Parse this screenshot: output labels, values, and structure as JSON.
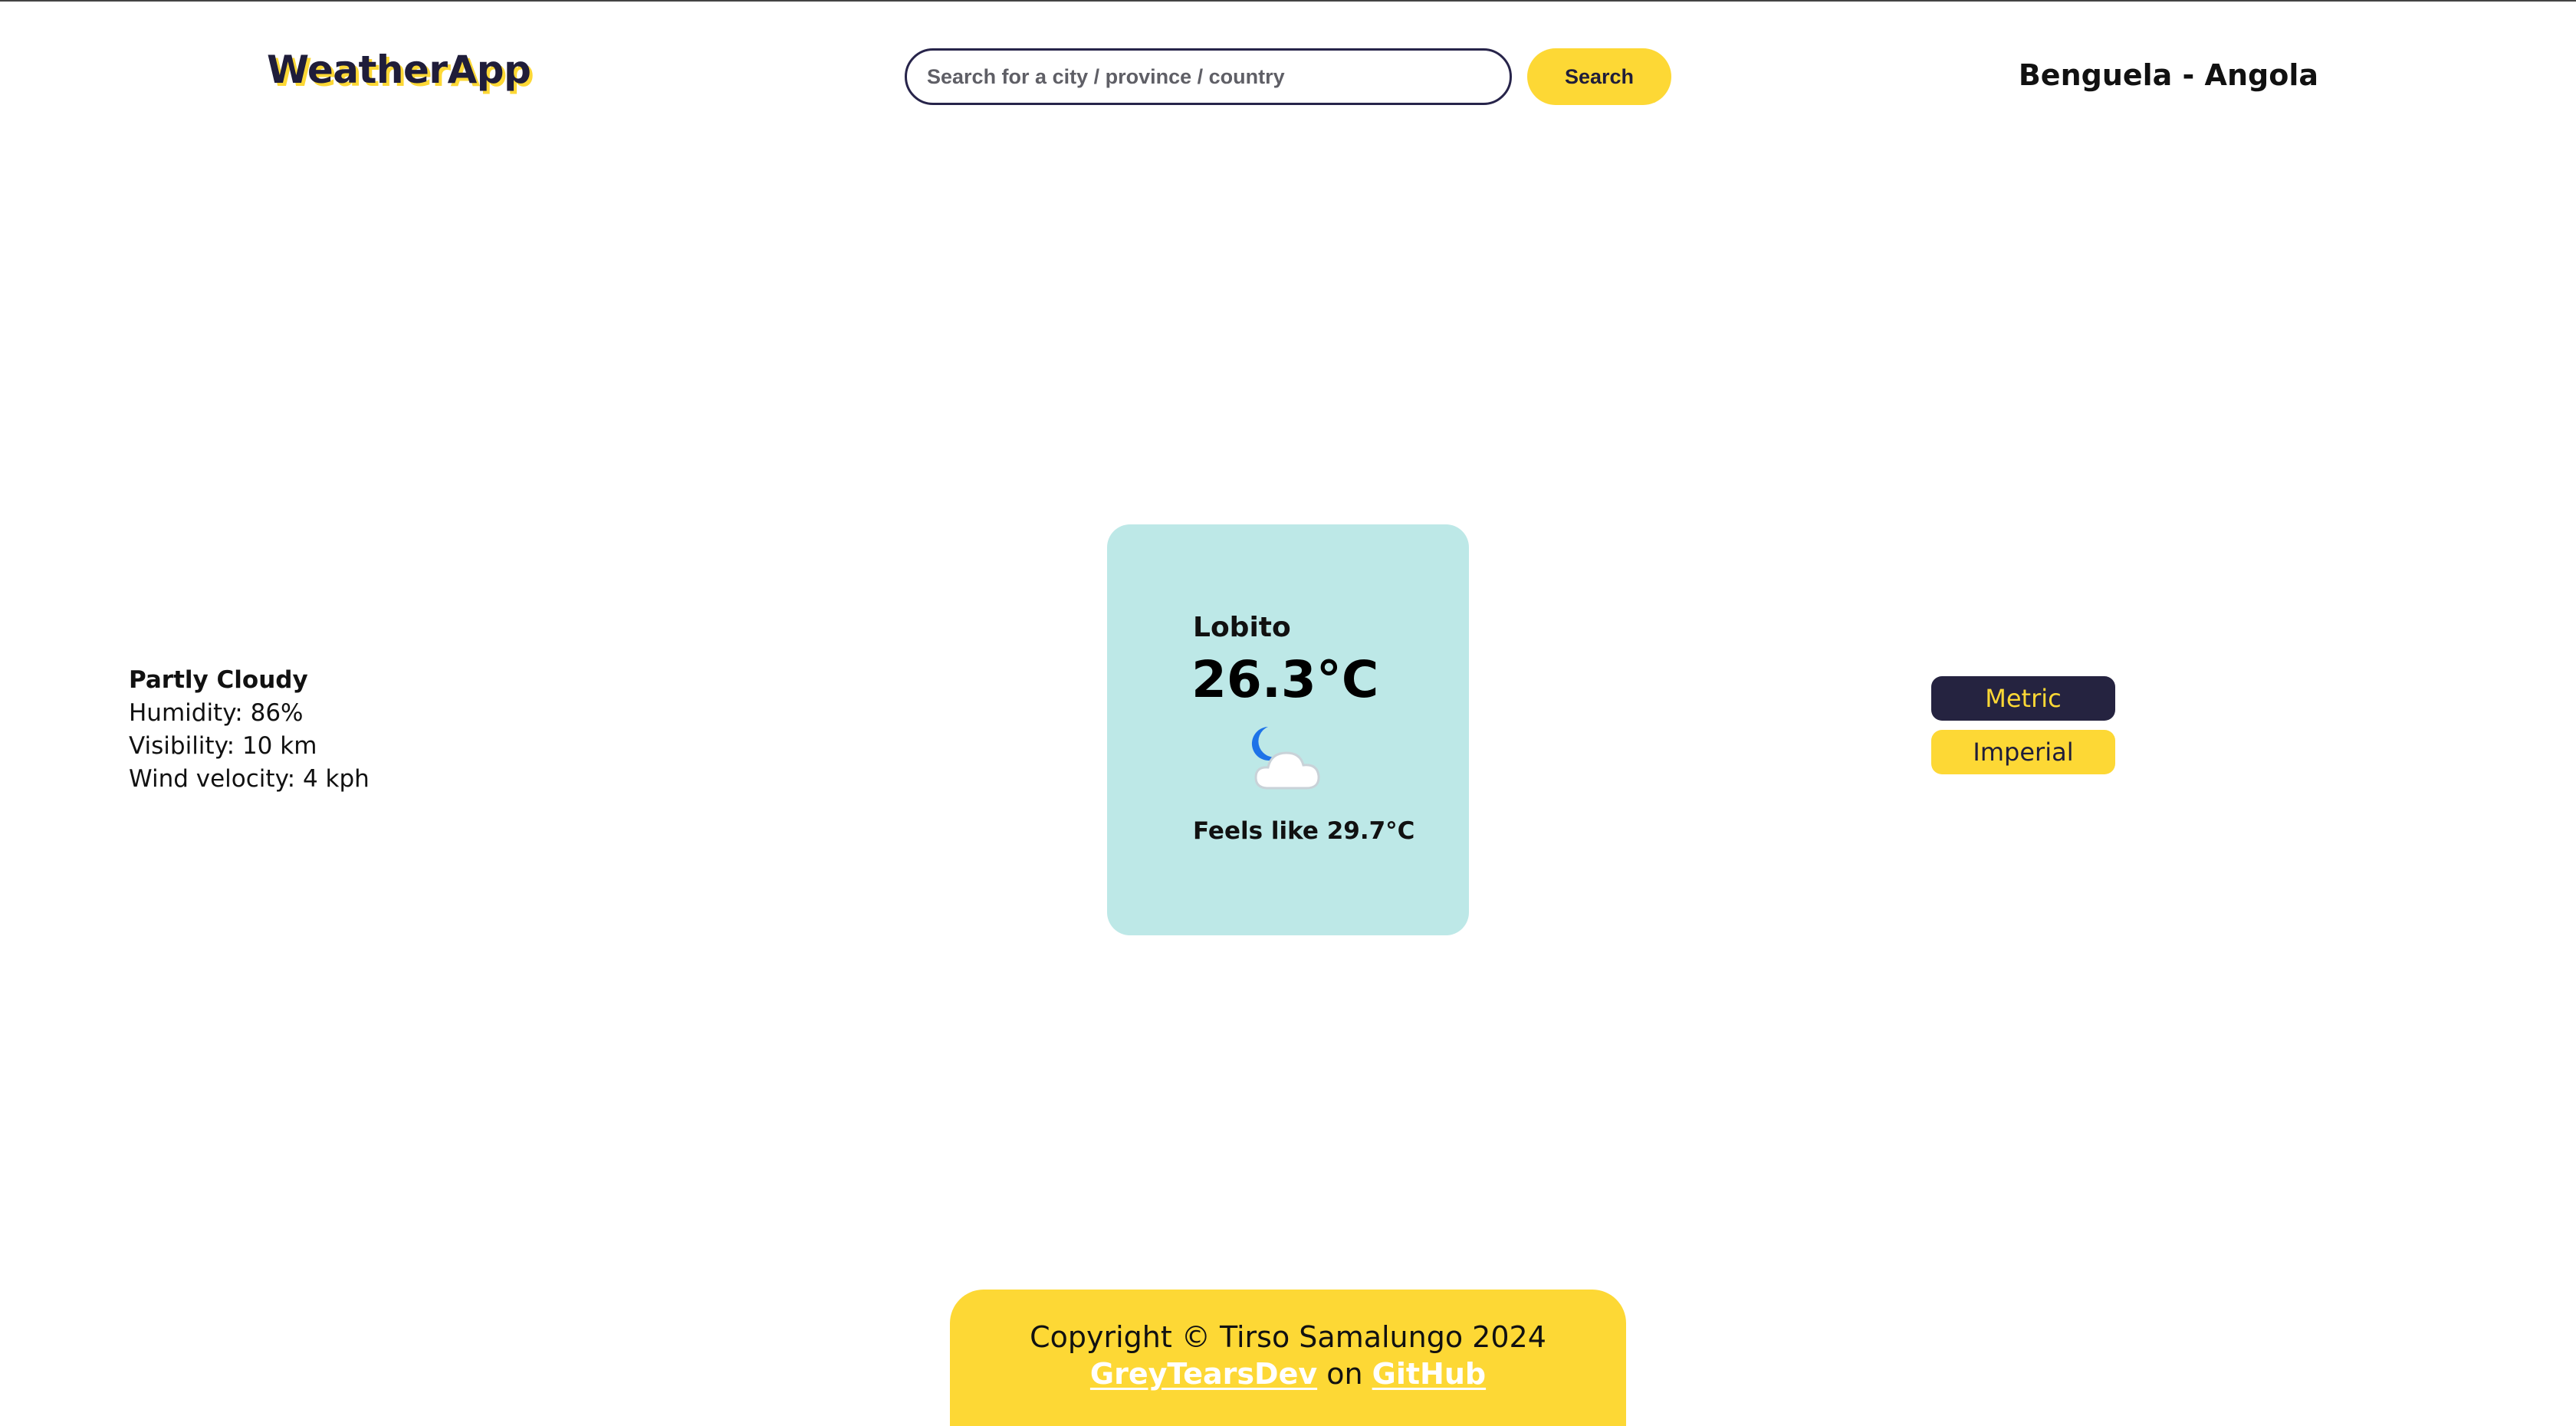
{
  "header": {
    "logo": "WeatherApp",
    "search_placeholder": "Search for a city / province / country",
    "search_value": "",
    "search_button": "Search",
    "current_location": "Benguela - Angola"
  },
  "details": {
    "condition": "Partly Cloudy",
    "humidity": "Humidity: 86%",
    "visibility": "Visibility: 10 km",
    "wind": "Wind velocity: 4 kph"
  },
  "card": {
    "city": "Lobito",
    "temperature": "26.3°C",
    "icon": "partly-cloudy-night-icon",
    "feels_like": "Feels like 29.7°C"
  },
  "units": {
    "metric_label": "Metric",
    "imperial_label": "Imperial",
    "selected": "Metric"
  },
  "footer": {
    "copyright": "Copyright © Tirso Samalungo 2024",
    "author_link": "GreyTearsDev",
    "on_text": "on",
    "github_link": "GitHub"
  },
  "colors": {
    "accent_yellow": "#fdd835",
    "navy": "#252340",
    "card_bg": "#bde8e7"
  }
}
